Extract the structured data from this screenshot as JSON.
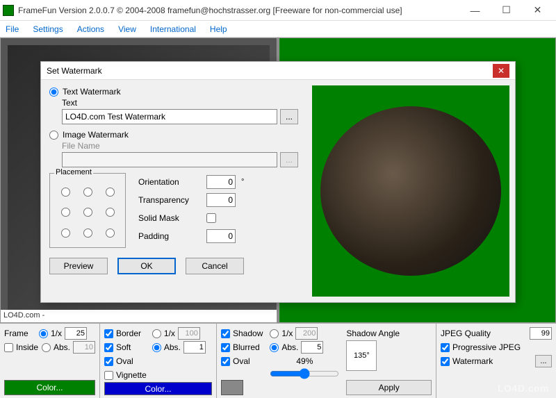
{
  "window": {
    "title": "FrameFun Version 2.0.0.7 © 2004-2008 framefun@hochstrasser.org [Freeware for non-commercial use]"
  },
  "menu": {
    "file": "File",
    "settings": "Settings",
    "actions": "Actions",
    "view": "View",
    "international": "International",
    "help": "Help"
  },
  "status_left": "LO4D.com -",
  "dialog": {
    "title": "Set Watermark",
    "text_watermark_label": "Text Watermark",
    "text_label": "Text",
    "text_value": "LO4D.com Test Watermark",
    "image_watermark_label": "Image Watermark",
    "filename_label": "File Name",
    "filename_value": "",
    "browse": "...",
    "placement_label": "Placement",
    "orientation_label": "Orientation",
    "orientation_value": "0",
    "degree": "°",
    "transparency_label": "Transparency",
    "transparency_value": "0",
    "solidmask_label": "Solid Mask",
    "padding_label": "Padding",
    "padding_value": "0",
    "preview_btn": "Preview",
    "ok_btn": "OK",
    "cancel_btn": "Cancel"
  },
  "frame": {
    "title": "Frame",
    "one_over_x": "1/x",
    "one_over_x_val": "25",
    "abs": "Abs.",
    "abs_val": "10",
    "inside": "Inside",
    "color": "Color..."
  },
  "border": {
    "border": "Border",
    "soft": "Soft",
    "oval": "Oval",
    "vignette": "Vignette",
    "one_over_x": "1/x",
    "one_over_x_val": "100",
    "abs": "Abs.",
    "abs_val": "1",
    "color": "Color..."
  },
  "shadow": {
    "shadow": "Shadow",
    "blurred": "Blurred",
    "oval": "Oval",
    "one_over_x": "1/x",
    "one_over_x_val": "200",
    "abs": "Abs.",
    "abs_val": "5",
    "percent": "49%",
    "angle_label": "Shadow Angle",
    "angle_val": "135°",
    "apply": "Apply"
  },
  "jpeg": {
    "quality_label": "JPEG Quality",
    "quality_val": "99",
    "progressive": "Progressive JPEG",
    "watermark": "Watermark",
    "browse": "..."
  },
  "brand": "LO4D.com"
}
